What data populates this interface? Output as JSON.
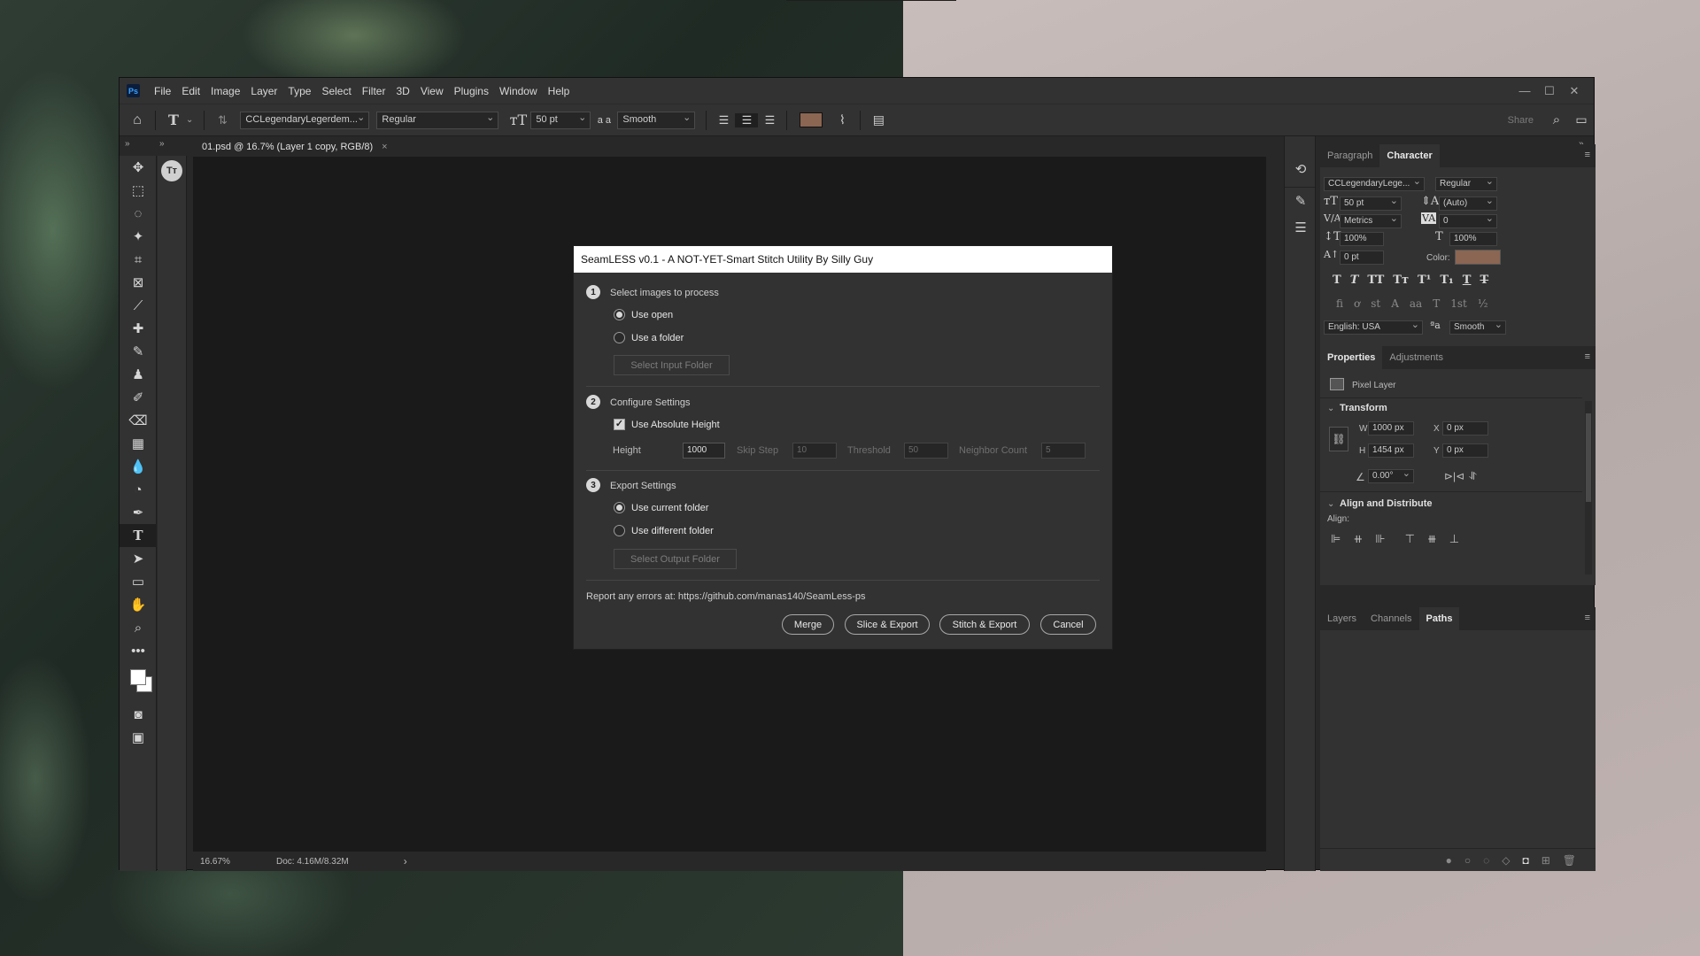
{
  "app": {
    "logo": "Ps",
    "menu": [
      "File",
      "Edit",
      "Image",
      "Layer",
      "Type",
      "Select",
      "Filter",
      "3D",
      "View",
      "Plugins",
      "Window",
      "Help"
    ],
    "window_controls": [
      "—",
      "☐",
      "✕"
    ]
  },
  "options_bar": {
    "font_family": "CCLegendaryLegerdem...",
    "font_style": "Regular",
    "font_size": "50 pt",
    "aa_label": "a a",
    "antialias": "Smooth",
    "share": "Share",
    "text_color": "#8b6652"
  },
  "document": {
    "tab_title": "01.psd @ 16.7% (Layer 1 copy, RGB/8)",
    "tab_close": "×",
    "zoom": "16.67%",
    "doc_info": "Doc: 4.16M/8.32M",
    "status_arrow": "›"
  },
  "character_panel": {
    "tabs": [
      "Paragraph",
      "Character"
    ],
    "font_family": "CCLegendaryLege...",
    "font_style": "Regular",
    "font_size": "50 pt",
    "leading": "(Auto)",
    "kerning": "Metrics",
    "tracking": "0",
    "vertical_scale": "100%",
    "horizontal_scale": "100%",
    "baseline_shift": "0 pt",
    "color_label": "Color:",
    "language": "English: USA",
    "antialias": "Smooth"
  },
  "properties_panel": {
    "tabs": [
      "Properties",
      "Adjustments"
    ],
    "layer_type": "Pixel Layer",
    "transform_label": "Transform",
    "w_label": "W",
    "w": "1000 px",
    "h_label": "H",
    "h": "1454 px",
    "x_label": "X",
    "x": "0 px",
    "y_label": "Y",
    "y": "0 px",
    "angle": "0.00°",
    "align_distribute_label": "Align and Distribute",
    "align_label": "Align:"
  },
  "layers_panel": {
    "tabs": [
      "Layers",
      "Channels",
      "Paths"
    ]
  },
  "dialog": {
    "title": "SeamLESS v0.1 - A NOT-YET-Smart Stitch Utility By Silly Guy",
    "step1": {
      "num": "1",
      "label": "Select images to process",
      "option_use_open": "Use open",
      "option_use_folder": "Use a folder",
      "select_input_folder": "Select Input Folder"
    },
    "step2": {
      "num": "2",
      "label": "Configure Settings",
      "use_absolute_height": "Use Absolute Height",
      "height_label": "Height",
      "height_value": "1000",
      "skip_step_label": "Skip Step",
      "skip_step_value": "10",
      "threshold_label": "Threshold",
      "threshold_value": "50",
      "neighbor_count_label": "Neighbor Count",
      "neighbor_count_value": "5"
    },
    "step3": {
      "num": "3",
      "label": "Export Settings",
      "option_current_folder": "Use current folder",
      "option_different_folder": "Use different folder",
      "select_output_folder": "Select Output Folder"
    },
    "report_text": "Report any errors at: https://github.com/manas140/SeamLess-ps",
    "buttons": {
      "merge": "Merge",
      "slice_export": "Slice & Export",
      "stitch_export": "Stitch & Export",
      "cancel": "Cancel"
    }
  }
}
